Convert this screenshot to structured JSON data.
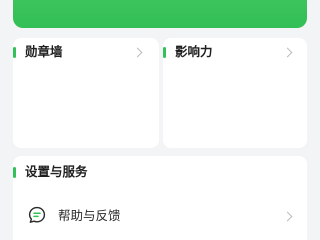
{
  "colors": {
    "accent": "#35c159",
    "hero": "#3cc45c",
    "background": "#f2f4f5",
    "card": "#ffffff",
    "chevron": "#b9bcbf"
  },
  "cards": {
    "badge": {
      "title": "勋章墙",
      "chevron": "chevron-right-icon"
    },
    "influence": {
      "title": "影响力",
      "chevron": "chevron-right-icon"
    }
  },
  "service": {
    "title": "设置与服务",
    "items": [
      {
        "label": "帮助与反馈",
        "icon": "chat-bubble-icon",
        "chevron": "chevron-right-icon"
      }
    ]
  }
}
